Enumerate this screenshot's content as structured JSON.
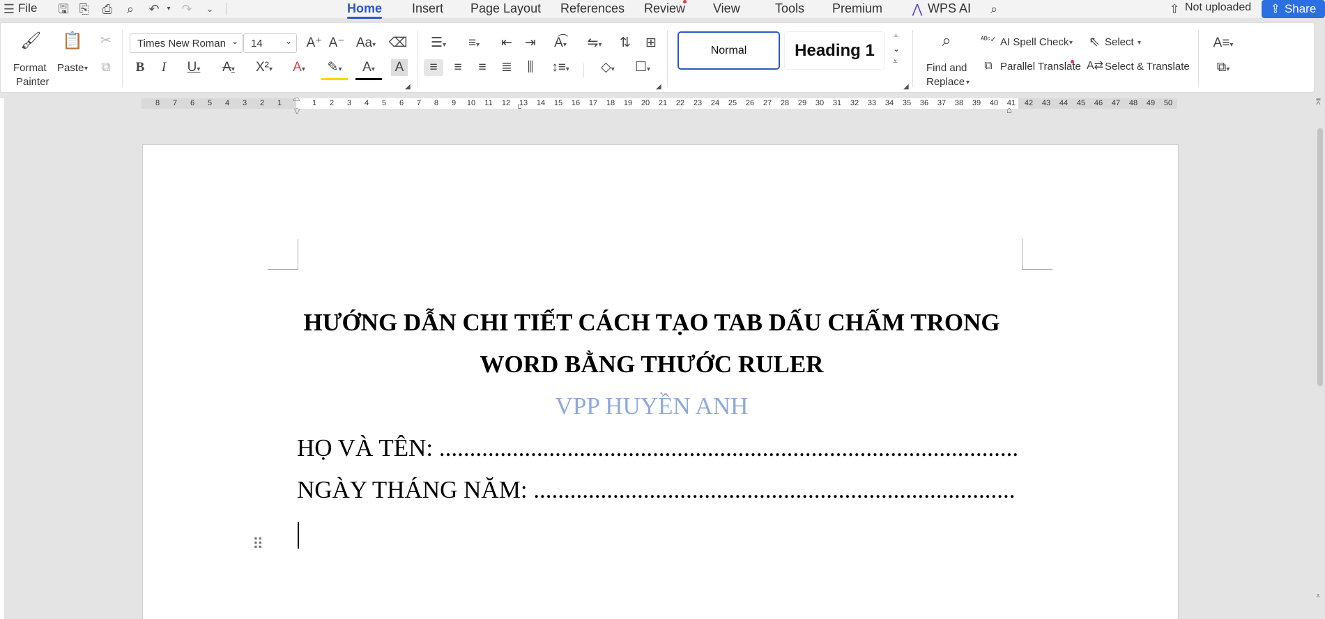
{
  "menubar": {
    "file": "File",
    "tabs": [
      "Home",
      "Insert",
      "Page Layout",
      "References",
      "Review",
      "View",
      "Tools",
      "Premium"
    ],
    "wps_ai": "WPS AI",
    "not_uploaded": "Not uploaded",
    "share": "Share"
  },
  "ribbon": {
    "format_painter_1": "Format",
    "format_painter_2": "Painter",
    "paste": "Paste",
    "font_name": "Times New Roman",
    "font_size": "14",
    "style_normal": "Normal",
    "style_heading1": "Heading 1",
    "find_replace_1": "Find and",
    "find_replace_2": "Replace",
    "ai_spell_check": "AI Spell Check",
    "select": "Select",
    "parallel_translate": "Parallel Translate",
    "select_translate": "Select & Translate"
  },
  "ruler": {
    "left_numbers": [
      "8",
      "7",
      "6",
      "5",
      "4",
      "3",
      "2",
      "1"
    ],
    "right_numbers": [
      "1",
      "2",
      "3",
      "4",
      "5",
      "6",
      "7",
      "8",
      "9",
      "10",
      "11",
      "12",
      "13",
      "14",
      "15",
      "16",
      "17",
      "18",
      "19",
      "20",
      "21",
      "22",
      "23",
      "24",
      "25",
      "26",
      "27",
      "28",
      "29",
      "30",
      "31",
      "32",
      "33",
      "34",
      "35",
      "36",
      "37",
      "38",
      "39",
      "40",
      "41",
      "42",
      "43",
      "44",
      "45",
      "46",
      "47",
      "48",
      "49",
      "50"
    ]
  },
  "document": {
    "title_line1": "HƯỚNG DẪN CHI TIẾT CÁCH TẠO TAB DẤU CHẤM TRONG",
    "title_line2": "WORD BẰNG THƯỚC RULER",
    "subtitle": "VPP HUYỀN ANH",
    "line1": "HỌ VÀ TÊN: ...............................................................................................",
    "line2": "NGÀY THÁNG NĂM: ..............................................................................."
  },
  "colors": {
    "accent": "#2b59c3",
    "subtitle": "#8eaadb",
    "share_bg": "#2b6fe0"
  }
}
